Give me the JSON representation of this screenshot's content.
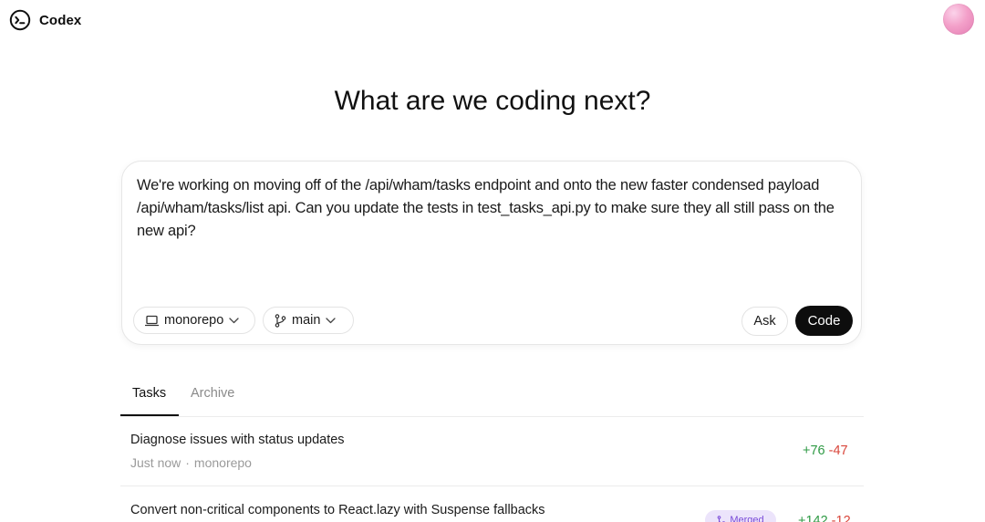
{
  "app": {
    "name": "Codex"
  },
  "headline": "What are we coding next?",
  "composer": {
    "prompt": "We're working on moving off of the /api/wham/tasks endpoint and onto the new faster condensed payload /api/wham/tasks/list api. Can you update the tests in test_tasks_api.py to make sure they all still pass on the new api?",
    "repo": "monorepo",
    "branch": "main",
    "ask_label": "Ask",
    "code_label": "Code"
  },
  "tabs": [
    "Tasks",
    "Archive"
  ],
  "active_tab": "Tasks",
  "tasks": [
    {
      "title": "Diagnose issues with status updates",
      "time": "Just now",
      "repo": "monorepo",
      "additions": "+76",
      "deletions": "-47"
    },
    {
      "title": "Convert non-critical components to React.lazy with Suspense fallbacks",
      "badge": "Merged",
      "additions": "+142",
      "deletions": "-12"
    }
  ],
  "colors": {
    "additions": "#2f9a45",
    "deletions": "#d9463b",
    "badge_bg": "#ece4fb",
    "badge_fg": "#7a4bd8",
    "primary_button": "#0d0d0d"
  },
  "icons": [
    "codex-logo-icon",
    "laptop-icon",
    "chevron-down-icon",
    "branch-icon",
    "merge-icon"
  ]
}
